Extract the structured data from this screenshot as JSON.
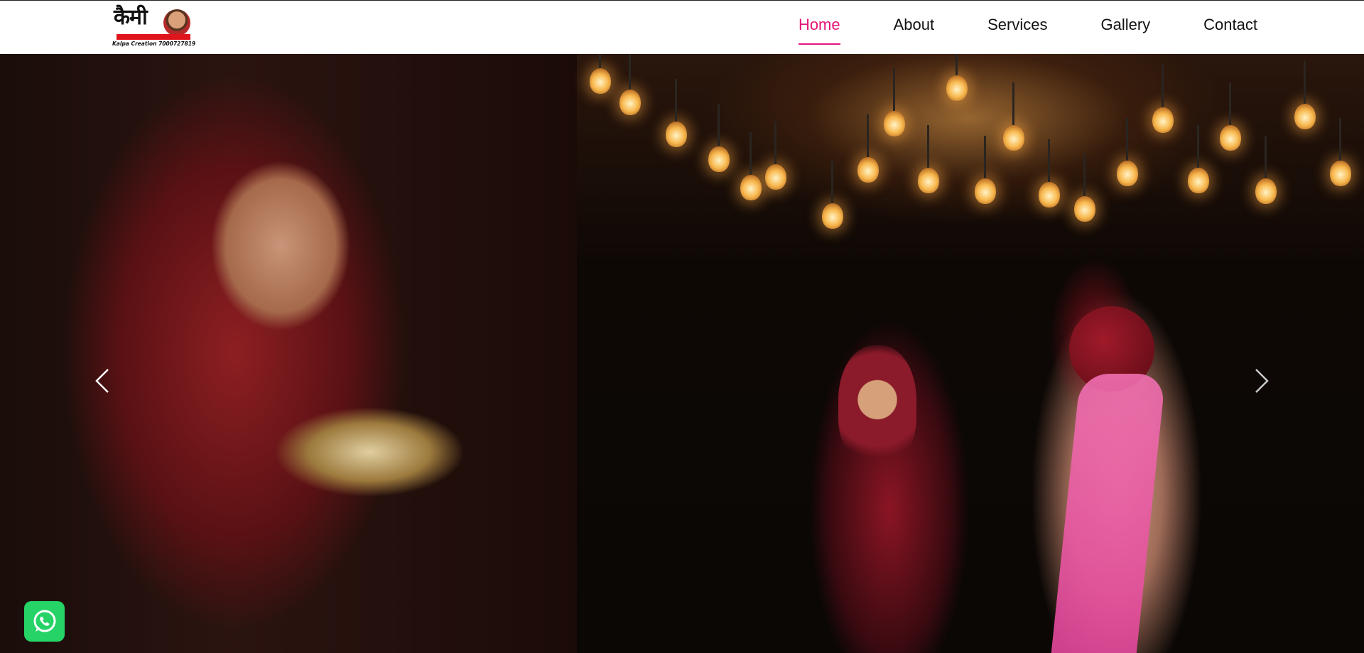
{
  "header": {
    "logo": {
      "script_text": "कैमी",
      "caption": "Kalpa Creation 7000727819"
    },
    "nav": [
      {
        "label": "Home",
        "active": true
      },
      {
        "label": "About",
        "active": false
      },
      {
        "label": "Services",
        "active": false
      },
      {
        "label": "Gallery",
        "active": false
      },
      {
        "label": "Contact",
        "active": false
      }
    ]
  },
  "hero": {
    "slider": {
      "prev_icon": "chevron-left-icon",
      "next_icon": "chevron-right-icon"
    }
  },
  "floating": {
    "whatsapp_icon": "whatsapp-icon"
  },
  "colors": {
    "accent": "#e5167a",
    "whatsapp": "#25d366",
    "header_bg": "#ffffff"
  }
}
